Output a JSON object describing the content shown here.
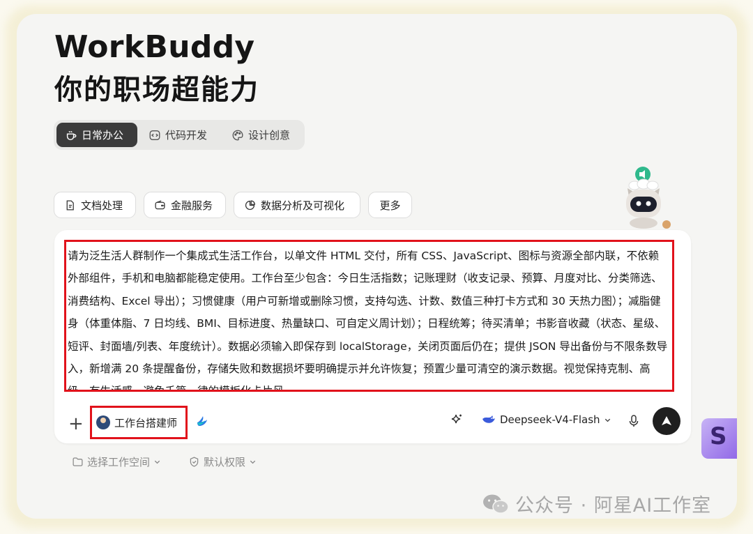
{
  "header": {
    "title": "WorkBuddy",
    "subtitle": "你的职场超能力"
  },
  "segments": [
    {
      "label": "日常办公",
      "icon": "coffee-cup-icon",
      "active": true
    },
    {
      "label": "代码开发",
      "icon": "code-icon",
      "active": false
    },
    {
      "label": "设计创意",
      "icon": "palette-icon",
      "active": false
    }
  ],
  "chips": [
    {
      "label": "文档处理",
      "icon": "document-icon"
    },
    {
      "label": "金融服务",
      "icon": "wallet-icon"
    },
    {
      "label": "数据分析及可视化",
      "icon": "pie-chart-icon"
    },
    {
      "label": "更多"
    }
  ],
  "composer": {
    "prompt_text": "请为泛生活人群制作一个集成式生活工作台，以单文件 HTML 交付，所有 CSS、JavaScript、图标与资源全部内联，不依赖外部组件，手机和电脑都能稳定使用。工作台至少包含：今日生活指数；记账理财（收支记录、预算、月度对比、分类筛选、消费结构、Excel 导出）；习惯健康（用户可新增或删除习惯，支持勾选、计数、数值三种打卡方式和 30 天热力图）；减脂健身（体重体脂、7 日均线、BMI、目标进度、热量缺口、可自定义周计划）；日程统筹；待买清单；书影音收藏（状态、星级、短评、封面墙/列表、年度统计）。数据必须输入即保存到 localStorage，关闭页面后仍在；提供 JSON 导出备份与不限条数导入，新增满 20 条提醒备份，存储失败和数据损坏要明确提示并允许恢复；预置少量可清空的演示数据。视觉保持克制、高级、有生活感，避免千篇一律的模板化卡片风。",
    "add_label": "+",
    "agent_label": "工作台搭建师",
    "model_label": "Deepseek-V4-Flash"
  },
  "footer": {
    "workspace_label": "选择工作空间",
    "permission_label": "默认权限"
  },
  "watermark": {
    "text": "公众号 · 阿星AI工作室"
  },
  "side_badge": "S",
  "colors": {
    "highlight_red": "#e1121b",
    "active_segment": "#3b3b3b",
    "model_blue": "#3b5bdb"
  }
}
